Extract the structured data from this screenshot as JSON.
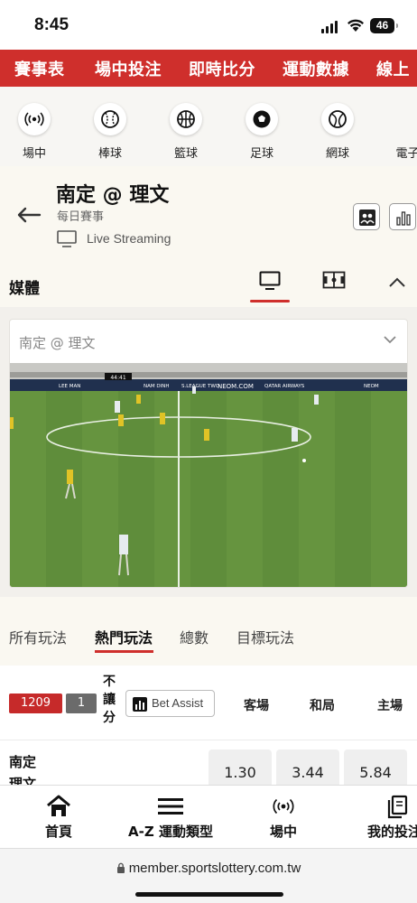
{
  "status_bar": {
    "time": "8:45",
    "battery": "46"
  },
  "top_nav": {
    "items": [
      "賽事表",
      "場中投注",
      "即時比分",
      "運動數據",
      "線上"
    ]
  },
  "sports_bar": {
    "items": [
      {
        "label": "場中",
        "icon": "live-signal-icon"
      },
      {
        "label": "棒球",
        "icon": "baseball-icon"
      },
      {
        "label": "籃球",
        "icon": "basketball-icon"
      },
      {
        "label": "足球",
        "icon": "soccer-icon"
      },
      {
        "label": "網球",
        "icon": "tennis-icon"
      },
      {
        "label": "電子競",
        "icon": "esports-icon"
      }
    ]
  },
  "match_header": {
    "title": "南定 @ 理文",
    "subtitle": "每日賽事",
    "streaming_label": "Live Streaming"
  },
  "media": {
    "title": "媒體",
    "selector_value": "南定 @ 理文",
    "video": {
      "scoreboard_time": "44:41",
      "ad_boards": [
        "LEE MAN",
        "NAM DINH",
        "S.LEAGUE TWO",
        "NEOM.COM",
        "QATAR AIRWAYS",
        "NEOM"
      ]
    }
  },
  "market_tabs": {
    "items": [
      "所有玩法",
      "熱門玩法",
      "總數",
      "目標玩法"
    ],
    "active_index": 1
  },
  "bet_header": {
    "event_code": "1209",
    "count": "1",
    "handicap_label": [
      "不",
      "讓",
      "分"
    ],
    "bet_assist_label": "Bet Assist",
    "columns": [
      "客場",
      "和局",
      "主場"
    ]
  },
  "odds_row": {
    "team_lines": [
      "南定",
      "理文"
    ],
    "odds": [
      "1.30",
      "3.44",
      "5.84"
    ]
  },
  "bottom_nav": {
    "items": [
      {
        "label": "首頁",
        "icon": "home-icon"
      },
      {
        "label": "A-Z 運動類型",
        "icon": "menu-icon"
      },
      {
        "label": "場中",
        "icon": "live-signal-icon"
      },
      {
        "label": "我的投注",
        "icon": "copy-icon"
      }
    ]
  },
  "url_bar": {
    "url": "member.sportslottery.com.tw"
  },
  "colors": {
    "brand_red": "#cf2f2c",
    "pitch_green": "#5c8a3a"
  }
}
